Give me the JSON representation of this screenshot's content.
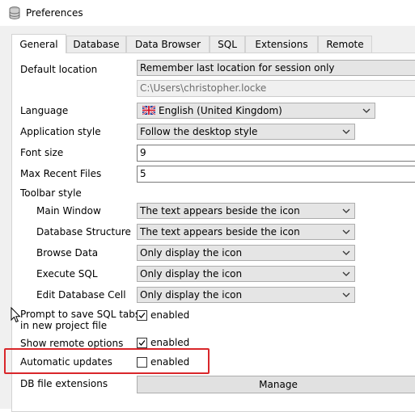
{
  "window": {
    "title": "Preferences"
  },
  "tabs": [
    {
      "label": "General",
      "active": true
    },
    {
      "label": "Database",
      "active": false
    },
    {
      "label": "Data Browser",
      "active": false
    },
    {
      "label": "SQL",
      "active": false
    },
    {
      "label": "Extensions",
      "active": false
    },
    {
      "label": "Remote",
      "active": false
    }
  ],
  "general": {
    "default_location": {
      "label": "Default location",
      "value": "Remember last location for session only",
      "path": "C:\\Users\\christopher.locke"
    },
    "language": {
      "label": "Language",
      "value": "English (United Kingdom)",
      "flag_icon": "uk-flag-icon"
    },
    "application_style": {
      "label": "Application style",
      "value": "Follow the desktop style"
    },
    "font_size": {
      "label": "Font size",
      "value": "9"
    },
    "max_recent_files": {
      "label": "Max Recent Files",
      "value": "5"
    },
    "toolbar_style": {
      "label": "Toolbar style",
      "main_window": {
        "label": "Main Window",
        "value": "The text appears beside the icon"
      },
      "database_structure": {
        "label": "Database Structure",
        "value": "The text appears beside the icon"
      },
      "browse_data": {
        "label": "Browse Data",
        "value": "Only display the icon"
      },
      "execute_sql": {
        "label": "Execute SQL",
        "value": "Only display the icon"
      },
      "edit_database_cell": {
        "label": "Edit Database Cell",
        "value": "Only display the icon"
      }
    },
    "prompt_save_sql": {
      "label_line1": "Prompt to save SQL tabs",
      "label_line2": "in new project file",
      "checkbox_label": "enabled",
      "checked": true
    },
    "show_remote_options": {
      "label": "Show remote options",
      "checkbox_label": "enabled",
      "checked": true
    },
    "automatic_updates": {
      "label": "Automatic updates",
      "checkbox_label": "enabled",
      "checked": false
    },
    "db_file_extensions": {
      "label": "DB file extensions",
      "button_label": "Manage"
    }
  },
  "colors": {
    "highlight": "#d9262a",
    "panel_bg": "#ffffff",
    "dialog_bg": "#f0f0f0"
  }
}
